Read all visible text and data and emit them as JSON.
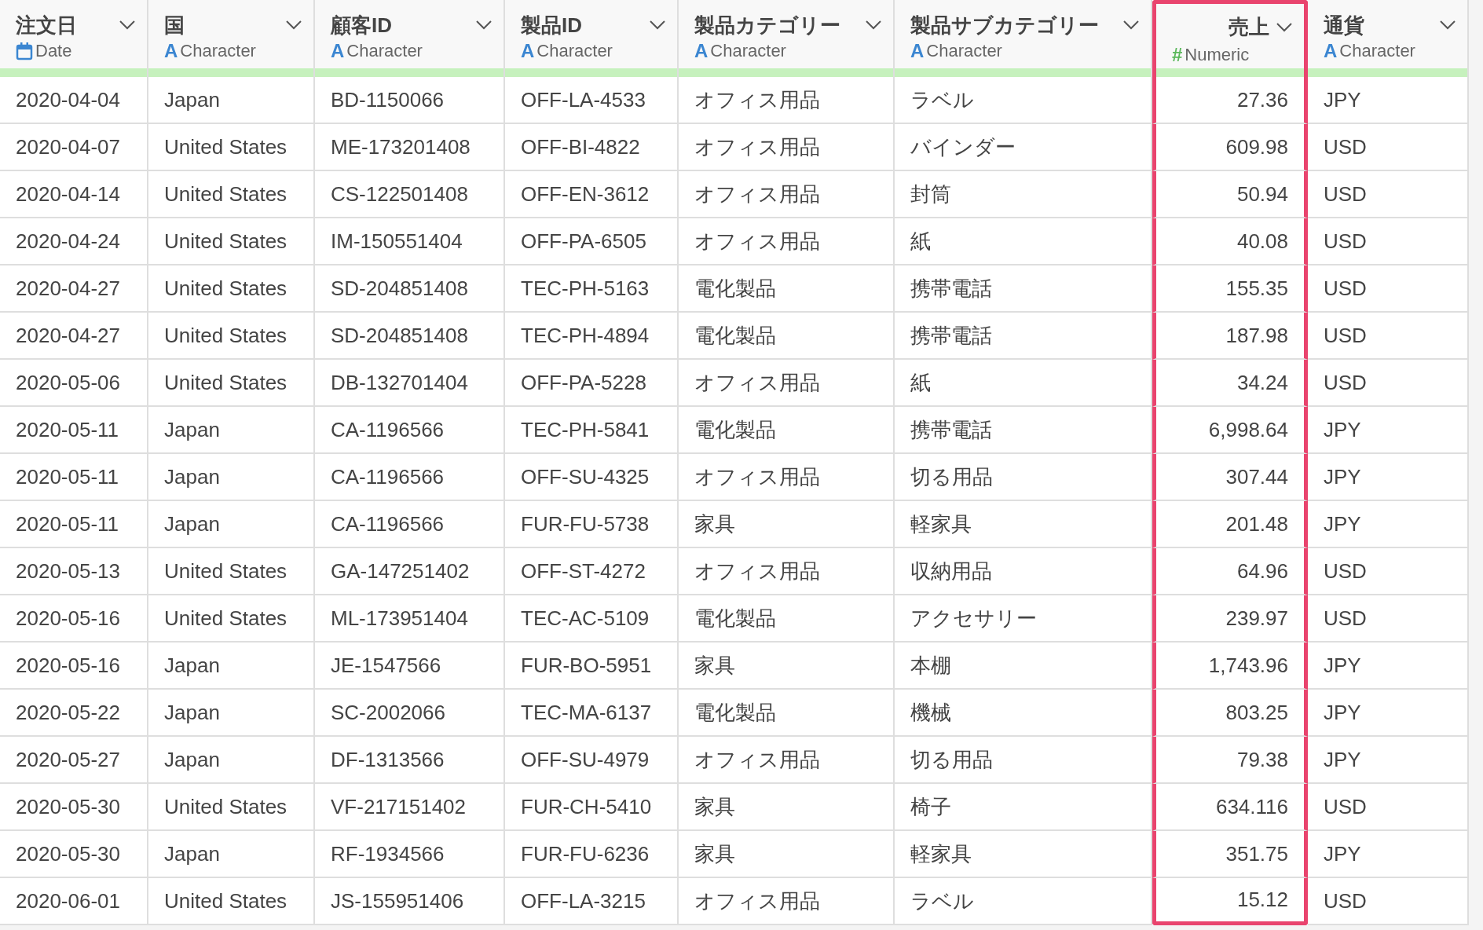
{
  "table": {
    "columns": [
      {
        "name": "注文日",
        "type": {
          "kind": "date",
          "label": "Date"
        },
        "selected": false
      },
      {
        "name": "国",
        "type": {
          "kind": "character",
          "glyph": "A",
          "label": "Character"
        },
        "selected": false
      },
      {
        "name": "顧客ID",
        "type": {
          "kind": "character",
          "glyph": "A",
          "label": "Character"
        },
        "selected": false
      },
      {
        "name": "製品ID",
        "type": {
          "kind": "character",
          "glyph": "A",
          "label": "Character"
        },
        "selected": false
      },
      {
        "name": "製品カテゴリー",
        "type": {
          "kind": "character",
          "glyph": "A",
          "label": "Character"
        },
        "selected": false
      },
      {
        "name": "製品サブカテゴリー",
        "type": {
          "kind": "character",
          "glyph": "A",
          "label": "Character"
        },
        "selected": false
      },
      {
        "name": "売上",
        "type": {
          "kind": "numeric",
          "glyph": "#",
          "label": "Numeric"
        },
        "selected": true
      },
      {
        "name": "通貨",
        "type": {
          "kind": "character",
          "glyph": "A",
          "label": "Character"
        },
        "selected": false
      }
    ],
    "rows": [
      [
        "2020-04-04",
        "Japan",
        "BD-1150066",
        "OFF-LA-4533",
        "オフィス用品",
        "ラベル",
        "27.36",
        "JPY"
      ],
      [
        "2020-04-07",
        "United States",
        "ME-173201408",
        "OFF-BI-4822",
        "オフィス用品",
        "バインダー",
        "609.98",
        "USD"
      ],
      [
        "2020-04-14",
        "United States",
        "CS-122501408",
        "OFF-EN-3612",
        "オフィス用品",
        "封筒",
        "50.94",
        "USD"
      ],
      [
        "2020-04-24",
        "United States",
        "IM-150551404",
        "OFF-PA-6505",
        "オフィス用品",
        "紙",
        "40.08",
        "USD"
      ],
      [
        "2020-04-27",
        "United States",
        "SD-204851408",
        "TEC-PH-5163",
        "電化製品",
        "携帯電話",
        "155.35",
        "USD"
      ],
      [
        "2020-04-27",
        "United States",
        "SD-204851408",
        "TEC-PH-4894",
        "電化製品",
        "携帯電話",
        "187.98",
        "USD"
      ],
      [
        "2020-05-06",
        "United States",
        "DB-132701404",
        "OFF-PA-5228",
        "オフィス用品",
        "紙",
        "34.24",
        "USD"
      ],
      [
        "2020-05-11",
        "Japan",
        "CA-1196566",
        "TEC-PH-5841",
        "電化製品",
        "携帯電話",
        "6,998.64",
        "JPY"
      ],
      [
        "2020-05-11",
        "Japan",
        "CA-1196566",
        "OFF-SU-4325",
        "オフィス用品",
        "切る用品",
        "307.44",
        "JPY"
      ],
      [
        "2020-05-11",
        "Japan",
        "CA-1196566",
        "FUR-FU-5738",
        "家具",
        "軽家具",
        "201.48",
        "JPY"
      ],
      [
        "2020-05-13",
        "United States",
        "GA-147251402",
        "OFF-ST-4272",
        "オフィス用品",
        "収納用品",
        "64.96",
        "USD"
      ],
      [
        "2020-05-16",
        "United States",
        "ML-173951404",
        "TEC-AC-5109",
        "電化製品",
        "アクセサリー",
        "239.97",
        "USD"
      ],
      [
        "2020-05-16",
        "Japan",
        "JE-1547566",
        "FUR-BO-5951",
        "家具",
        "本棚",
        "1,743.96",
        "JPY"
      ],
      [
        "2020-05-22",
        "Japan",
        "SC-2002066",
        "TEC-MA-6137",
        "電化製品",
        "機械",
        "803.25",
        "JPY"
      ],
      [
        "2020-05-27",
        "Japan",
        "DF-1313566",
        "OFF-SU-4979",
        "オフィス用品",
        "切る用品",
        "79.38",
        "JPY"
      ],
      [
        "2020-05-30",
        "United States",
        "VF-217151402",
        "FUR-CH-5410",
        "家具",
        "椅子",
        "634.116",
        "USD"
      ],
      [
        "2020-05-30",
        "Japan",
        "RF-1934566",
        "FUR-FU-6236",
        "家具",
        "軽家具",
        "351.75",
        "JPY"
      ],
      [
        "2020-06-01",
        "United States",
        "JS-155951406",
        "OFF-LA-3215",
        "オフィス用品",
        "ラベル",
        "15.12",
        "USD"
      ]
    ]
  }
}
